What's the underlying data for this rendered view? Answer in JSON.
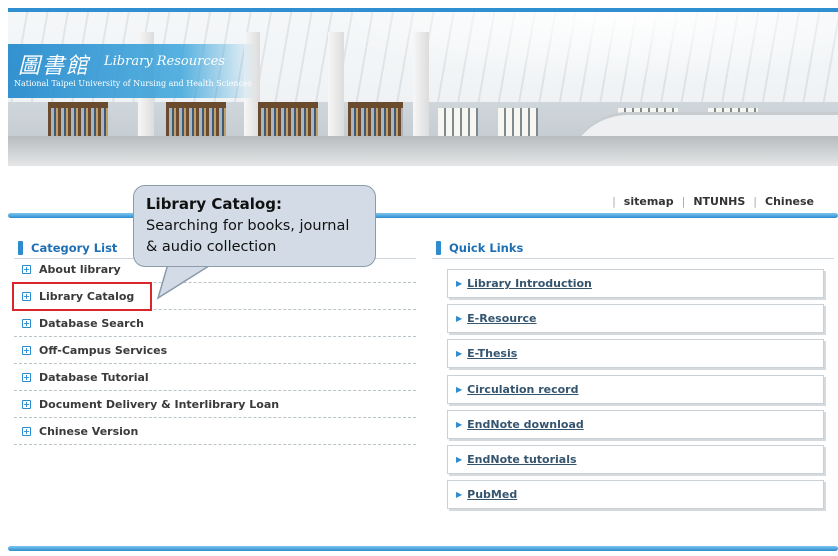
{
  "banner": {
    "title_chars": "圖書館",
    "title_en": "Library Resources",
    "subtitle": "National Taipei University of Nursing and Health Sciences"
  },
  "topnav": {
    "items": [
      "sitemap",
      "NTUNHS",
      "Chinese"
    ]
  },
  "callout": {
    "heading": "Library Catalog:",
    "line1": "Searching for books, journal",
    "line2": "& audio collection"
  },
  "category": {
    "title": "Category List",
    "items": [
      "About library",
      "Library Catalog",
      "Database Search",
      "Off-Campus Services",
      "Database Tutorial",
      "Document Delivery & Interlibrary Loan",
      "Chinese Version"
    ]
  },
  "quick_links": {
    "title": "Quick Links",
    "items": [
      "Library Introduction",
      "E-Resource",
      "E-Thesis",
      "Circulation record",
      "EndNote download",
      "EndNote tutorials",
      "PubMed"
    ]
  },
  "colors": {
    "accent": "#2d8ccd",
    "highlight": "#d9252b",
    "callout_bg": "#d3dce6"
  }
}
